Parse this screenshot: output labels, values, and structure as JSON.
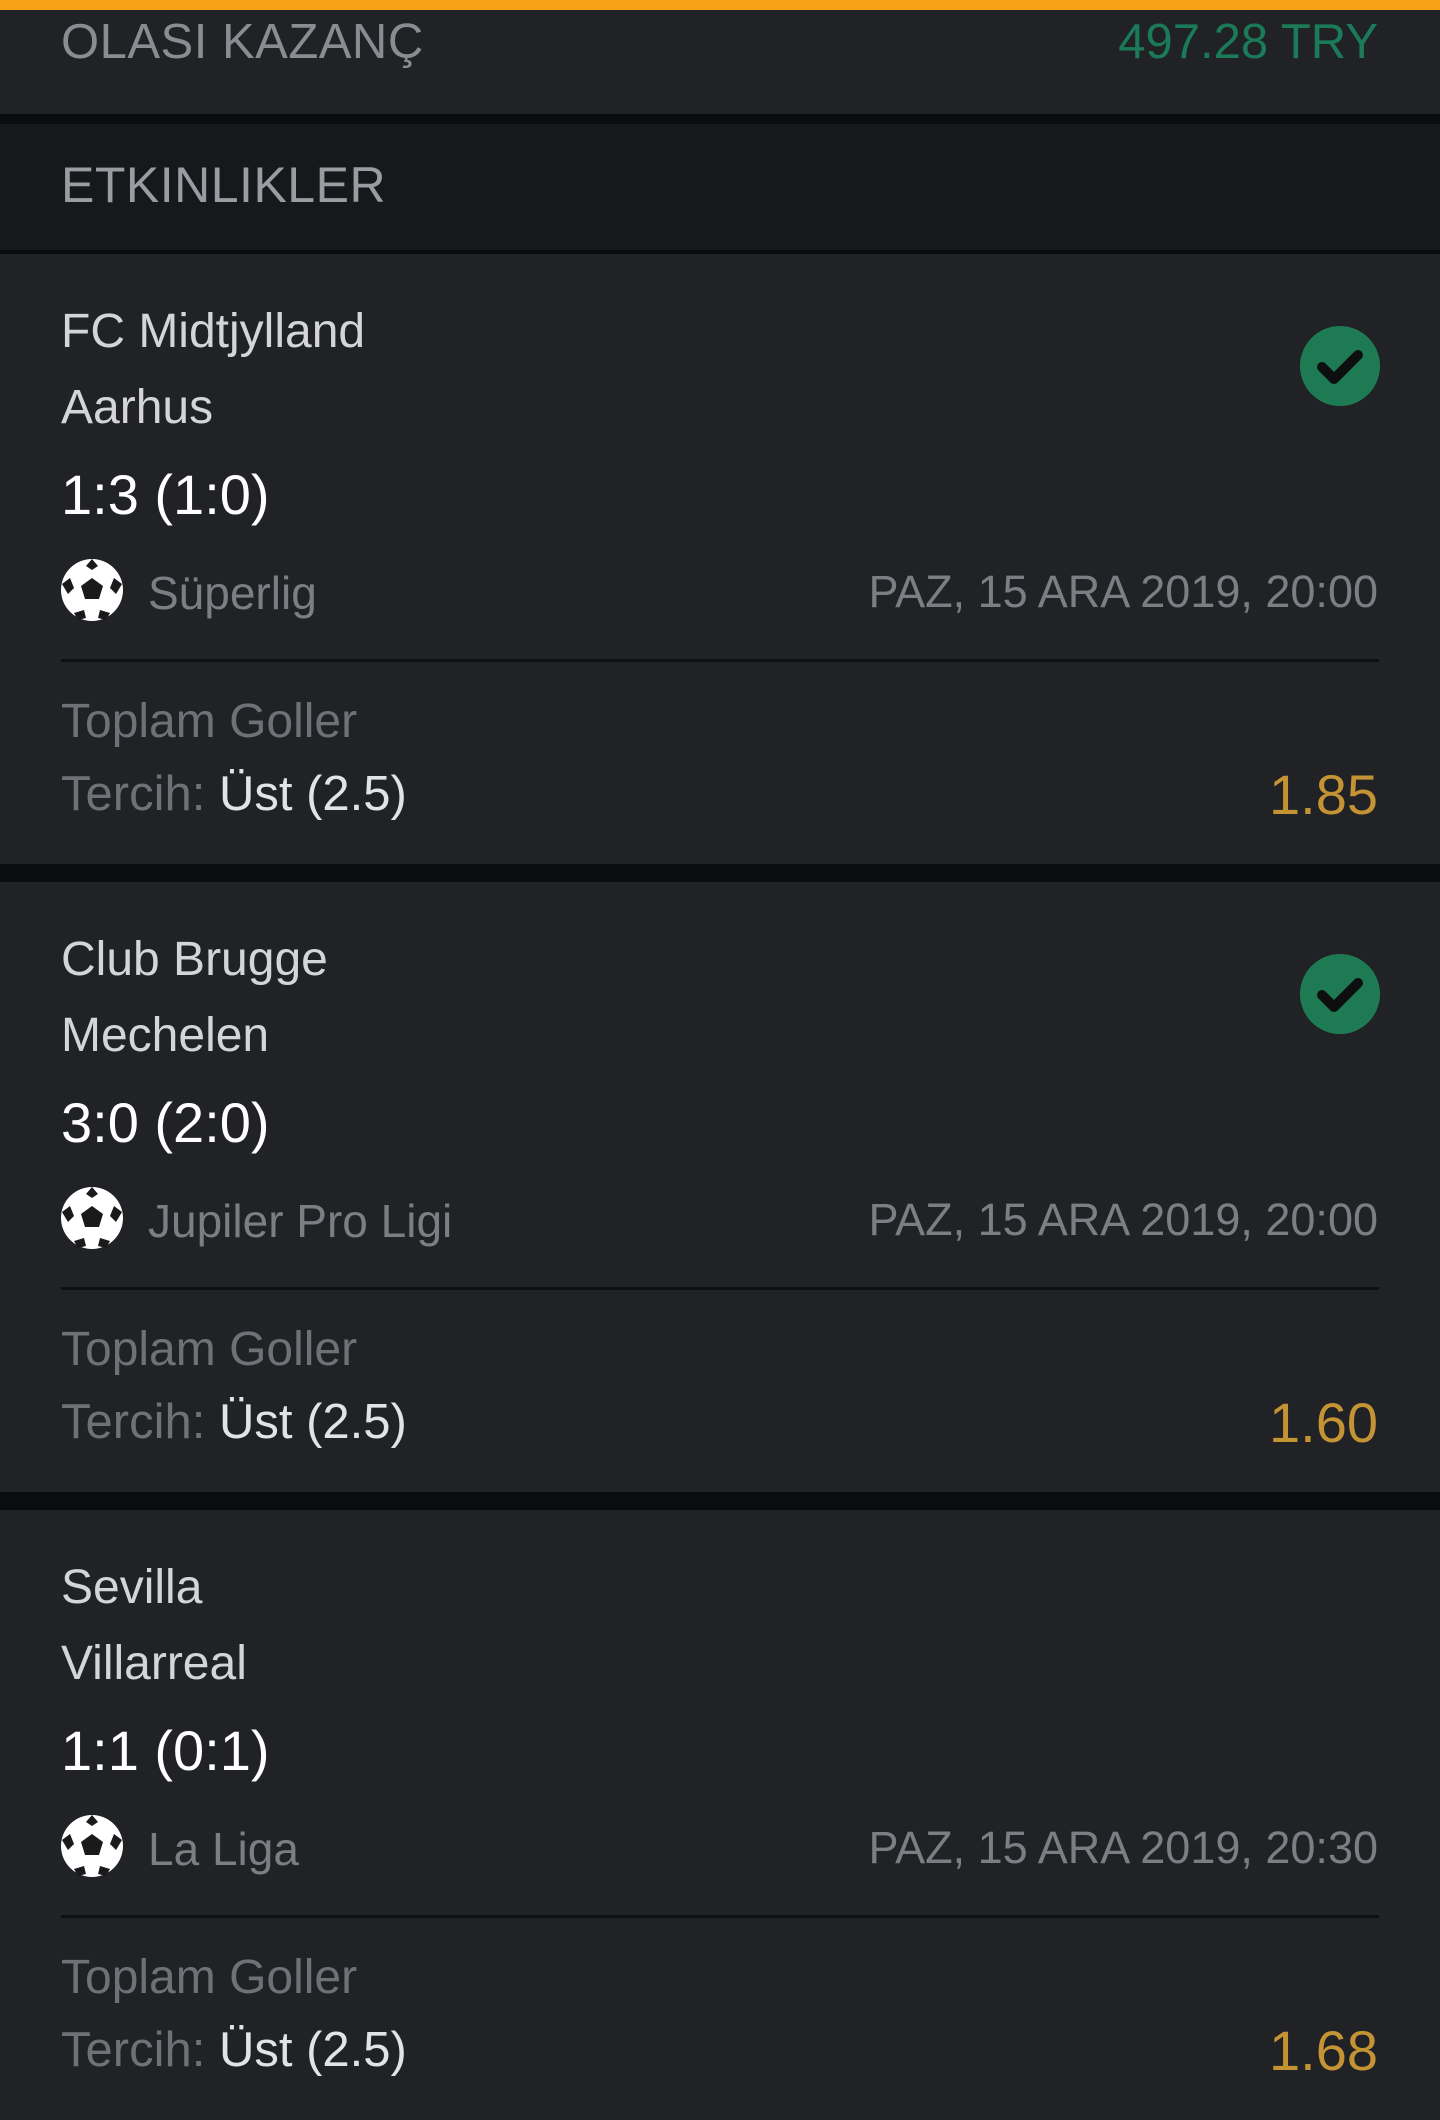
{
  "summary": {
    "label": "OLASI KAZANÇ",
    "value": "497.28 TRY",
    "value_color": "#1b7a57"
  },
  "section": {
    "title": "ETKINLIKLER"
  },
  "events": [
    {
      "team1": "FC Midtjylland",
      "team2": "Aarhus",
      "score": "1:3 (1:0)",
      "league": "Süperlig",
      "datetime": "PAZ, 15 ARA 2019, 20:00",
      "market": "Toplam Goller",
      "pick_label": "Tercih:",
      "pick_value": "Üst (2.5)",
      "odds": "1.85",
      "status": "won",
      "status_icon": "check-circle-icon"
    },
    {
      "team1": "Club Brugge",
      "team2": "Mechelen",
      "score": "3:0 (2:0)",
      "league": "Jupiler Pro Ligi",
      "datetime": "PAZ, 15 ARA 2019, 20:00",
      "market": "Toplam Goller",
      "pick_label": "Tercih:",
      "pick_value": "Üst (2.5)",
      "odds": "1.60",
      "status": "won",
      "status_icon": "check-circle-icon"
    },
    {
      "team1": "Sevilla",
      "team2": "Villarreal",
      "score": "1:1 (0:1)",
      "league": "La Liga",
      "datetime": "PAZ, 15 ARA 2019, 20:30",
      "market": "Toplam Goller",
      "pick_label": "Tercih:",
      "pick_value": "Üst (2.5)",
      "odds": "1.68",
      "status": "",
      "status_icon": ""
    }
  ],
  "colors": {
    "accent": "#f5a216",
    "odds": "#c49434",
    "success": "#1e7a52",
    "card_bg": "#212226",
    "page_bg": "#0b0c0e"
  }
}
